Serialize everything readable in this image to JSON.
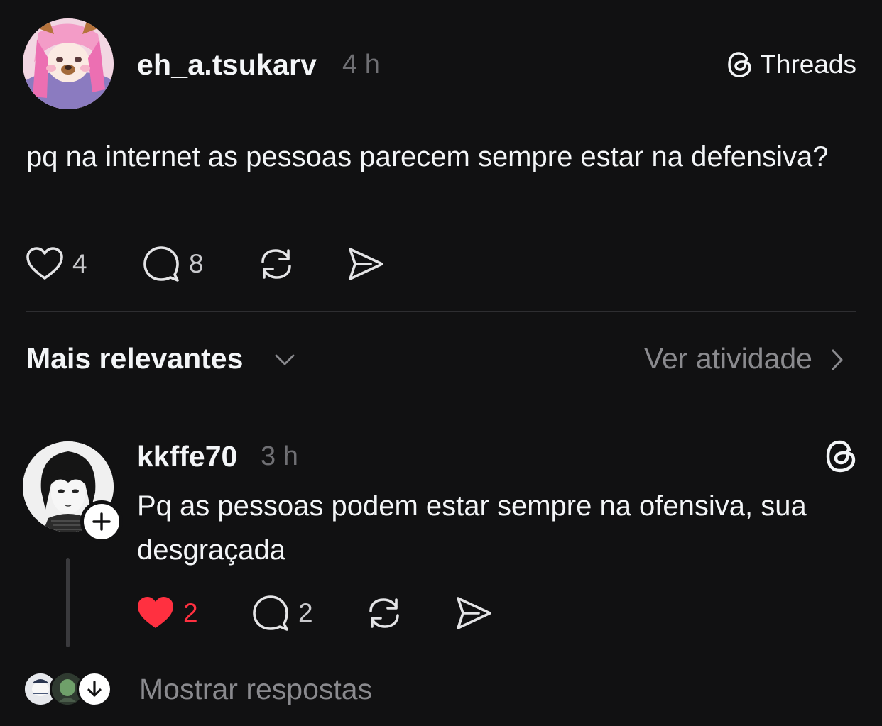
{
  "post": {
    "username": "eh_a.tsukarv",
    "time": "4 h",
    "brand": "Threads",
    "text": "pq na internet as pessoas parecem sempre estar na defensiva?",
    "likes": "4",
    "comments": "8",
    "avatar": "anime-character-avatar"
  },
  "sort": {
    "label": "Mais relevantes",
    "activity": "Ver atividade"
  },
  "reply": {
    "username": "kkffe70",
    "time": "3 h",
    "text": "Pq as pessoas podem estar sempre na ofensiva, sua desgraçada",
    "likes": "2",
    "liked": true,
    "comments": "2",
    "avatar": "manga-character-avatar"
  },
  "footer": {
    "show_replies": "Mostrar respostas"
  },
  "colors": {
    "background": "#111112",
    "text": "#f3f5f7",
    "muted": "#8a8a8e",
    "like_red": "#ff3040"
  }
}
